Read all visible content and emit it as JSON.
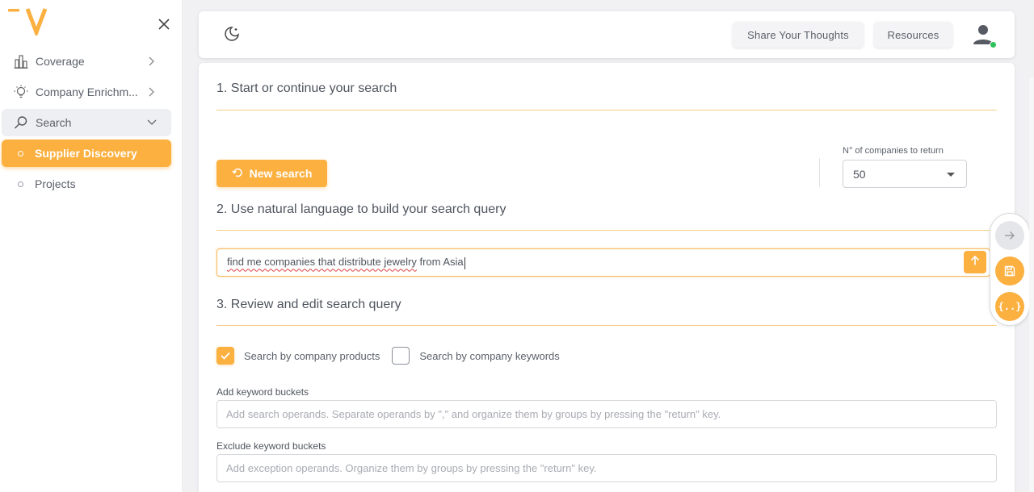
{
  "colors": {
    "accent": "#fbb040",
    "divider": "#f7cf85",
    "status_online": "#2fbf5b"
  },
  "sidebar": {
    "logo_icon": "brand-v-logo",
    "close_icon": "close-icon",
    "items": [
      {
        "label": "Coverage",
        "icon": "bar-chart-icon",
        "chevron": "chevron-right-icon"
      },
      {
        "label": "Company Enrichm...",
        "icon": "lightbulb-icon",
        "chevron": "chevron-right-icon"
      },
      {
        "label": "Search",
        "icon": "search-icon",
        "chevron": "chevron-down-icon"
      },
      {
        "label": "Supplier Discovery",
        "active": true
      },
      {
        "label": "Projects"
      }
    ]
  },
  "topbar": {
    "theme_icon": "moon-icon",
    "share_label": "Share Your Thoughts",
    "resources_label": "Resources",
    "avatar_icon": "user-icon"
  },
  "main": {
    "step1_title": "1. Start or continue your search",
    "new_search_label": "New search",
    "n_companies_label": "N° of companies to return",
    "n_companies_value": "50",
    "step2_title": "2. Use natural language to build your search query",
    "query_underlined": "find me companies that distribute jewelry",
    "query_rest": " from Asia",
    "step3_title": "3. Review and edit search query",
    "cb_products_label": "Search by company products",
    "cb_products_checked": true,
    "cb_keywords_label": "Search by company keywords",
    "cb_keywords_checked": false,
    "add_buckets_label": "Add keyword buckets",
    "add_buckets_placeholder": "Add search operands. Separate operands by \",\" and organize them by groups by pressing the \"return\" key.",
    "exclude_buckets_label": "Exclude keyword buckets",
    "exclude_buckets_placeholder": "Add exception operands. Organize them by groups by pressing the \"return\" key."
  },
  "float_actions": {
    "next_icon": "arrow-right-icon",
    "save_icon": "save-icon",
    "json_icon": "braces-icon",
    "json_glyph": "{..}"
  }
}
